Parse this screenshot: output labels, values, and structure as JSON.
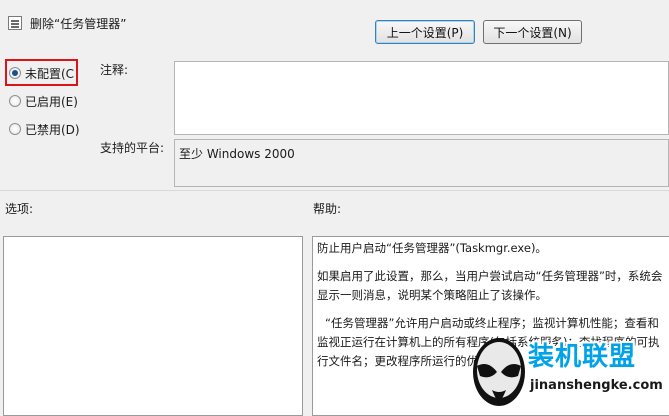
{
  "window": {
    "title": "删除“任务管理器”"
  },
  "nav": {
    "prev_label": "上一个设置(P)",
    "next_label": "下一个设置(N)"
  },
  "state": {
    "options": [
      {
        "label": "未配置(C",
        "checked": true
      },
      {
        "label": "已启用(E)",
        "checked": false
      },
      {
        "label": "已禁用(D)",
        "checked": false
      }
    ]
  },
  "comment": {
    "label": "注释:",
    "value": ""
  },
  "platform": {
    "label": "支持的平台:",
    "value": "至少 Windows 2000"
  },
  "options_section": {
    "label": "选项:"
  },
  "help_section": {
    "label": "帮助:",
    "paragraphs": [
      "防止用户启动“任务管理器”(Taskmgr.exe)。",
      "如果启用了此设置，那么，当用户尝试启动“任务管理器”时，系统会显示一则消息，说明某个策略阻止了该操作。",
      "“任务管理器”允许用户启动或终止程序；监视计算机性能；查看和监视正运行在计算机上的所有程序(包括系统服务)；查找程序的可执行文件名；更改程序所运行的优先级。"
    ]
  },
  "watermark": {
    "brand": "装机联盟",
    "url": "jinanshengke.com"
  }
}
